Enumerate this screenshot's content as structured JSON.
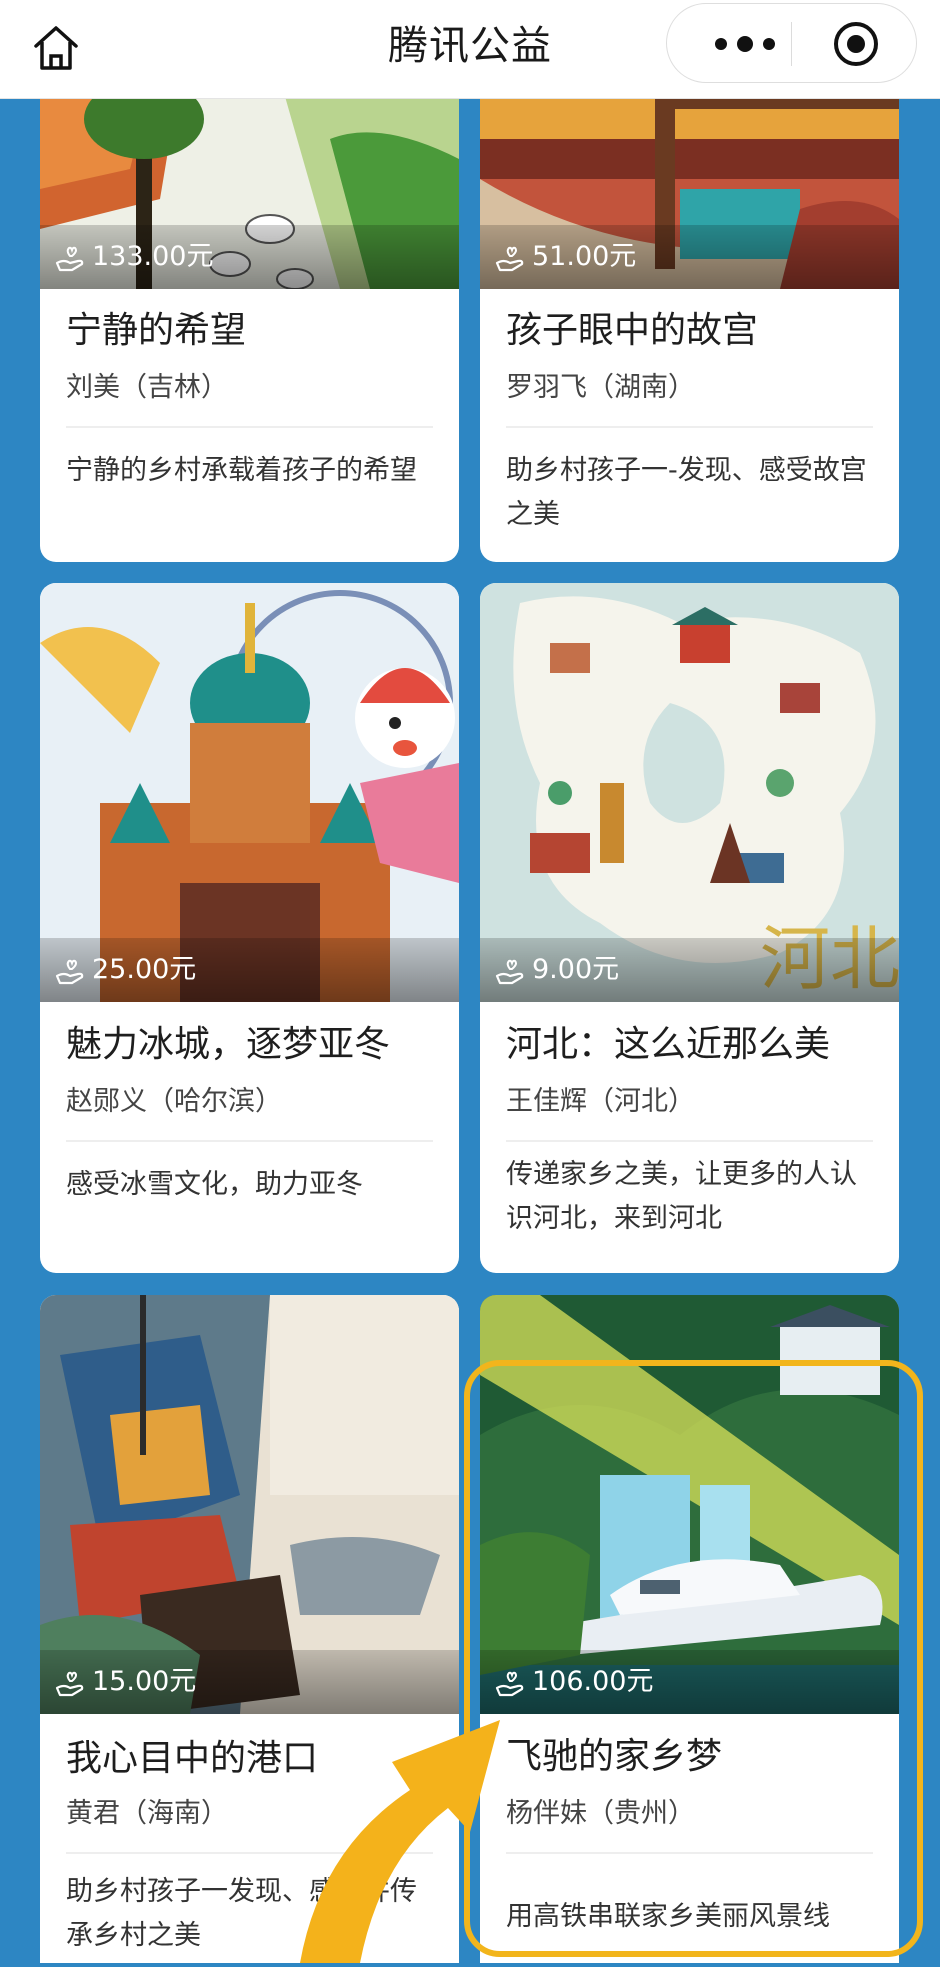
{
  "header": {
    "title": "腾讯公益",
    "home_icon": "home-icon",
    "more_icon": "more-dots-icon",
    "close_icon": "target-close-icon"
  },
  "colors": {
    "background": "#2d86c3",
    "highlight": "#f2b51c",
    "card": "#ffffff"
  },
  "cards": [
    {
      "price": "133.00元",
      "title": "宁静的希望",
      "author": "刘美（吉林）",
      "desc": "宁静的乡村承载着孩子的希望"
    },
    {
      "price": "51.00元",
      "title": "孩子眼中的故宫",
      "author": "罗羽飞（湖南）",
      "desc": "助乡村孩子一-发现、感受故宫之美"
    },
    {
      "price": "25.00元",
      "title": "魅力冰城，逐梦亚冬",
      "author": "赵郧义（哈尔滨）",
      "desc": "感受冰雪文化，助力亚冬"
    },
    {
      "price": "9.00元",
      "title": "河北：这么近那么美",
      "author": "王佳辉（河北）",
      "desc": "传递家乡之美，让更多的人认识河北，来到河北"
    },
    {
      "price": "15.00元",
      "title": "我心目中的港口",
      "author": "黄君（海南）",
      "desc": "助乡村孩子一发现、感受并传承乡村之美"
    },
    {
      "price": "106.00元",
      "title": "飞驰的家乡梦",
      "author": "杨伴妹（贵州）",
      "desc": "用高铁串联家乡美丽风景线"
    }
  ]
}
